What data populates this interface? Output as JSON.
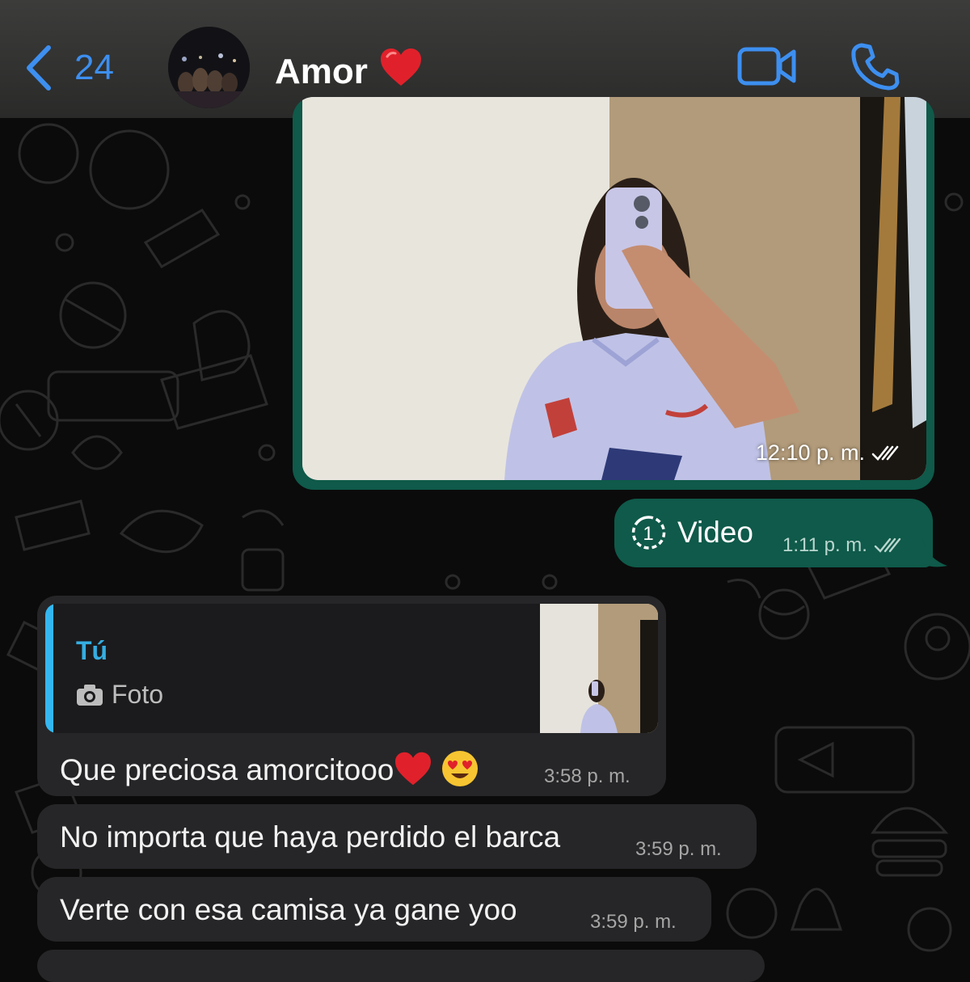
{
  "header": {
    "back_count": "24",
    "contact_name": "Amor",
    "name_emoji": "❤️"
  },
  "photo_message": {
    "time": "12:10 p. m."
  },
  "video_message": {
    "label": "Video",
    "time": "1:11 p. m."
  },
  "reply_message": {
    "quote_author": "Tú",
    "quote_type": "Foto",
    "text": "Que preciosa amorcitooo",
    "emojis": "❤️😍",
    "time": "3:58 p. m."
  },
  "messages": [
    {
      "text": "No importa que haya perdido el barca",
      "time": "3:59 p. m."
    },
    {
      "text": "Verte con esa camisa ya gane yoo",
      "time": "3:59 p. m."
    }
  ],
  "colors": {
    "accent_blue": "#3d8ff0",
    "outgoing_bubble": "#0f5a4a",
    "incoming_bubble": "#262628",
    "quote_bar": "#34b7f1",
    "quote_author": "#35aee2",
    "background": "#0b0b0b"
  },
  "icons": {
    "back": "chevron-left-icon",
    "video_call": "video-camera-icon",
    "voice_call": "phone-icon",
    "view_once": "view-once-icon",
    "read_receipt": "double-check-icon",
    "camera": "camera-icon"
  }
}
